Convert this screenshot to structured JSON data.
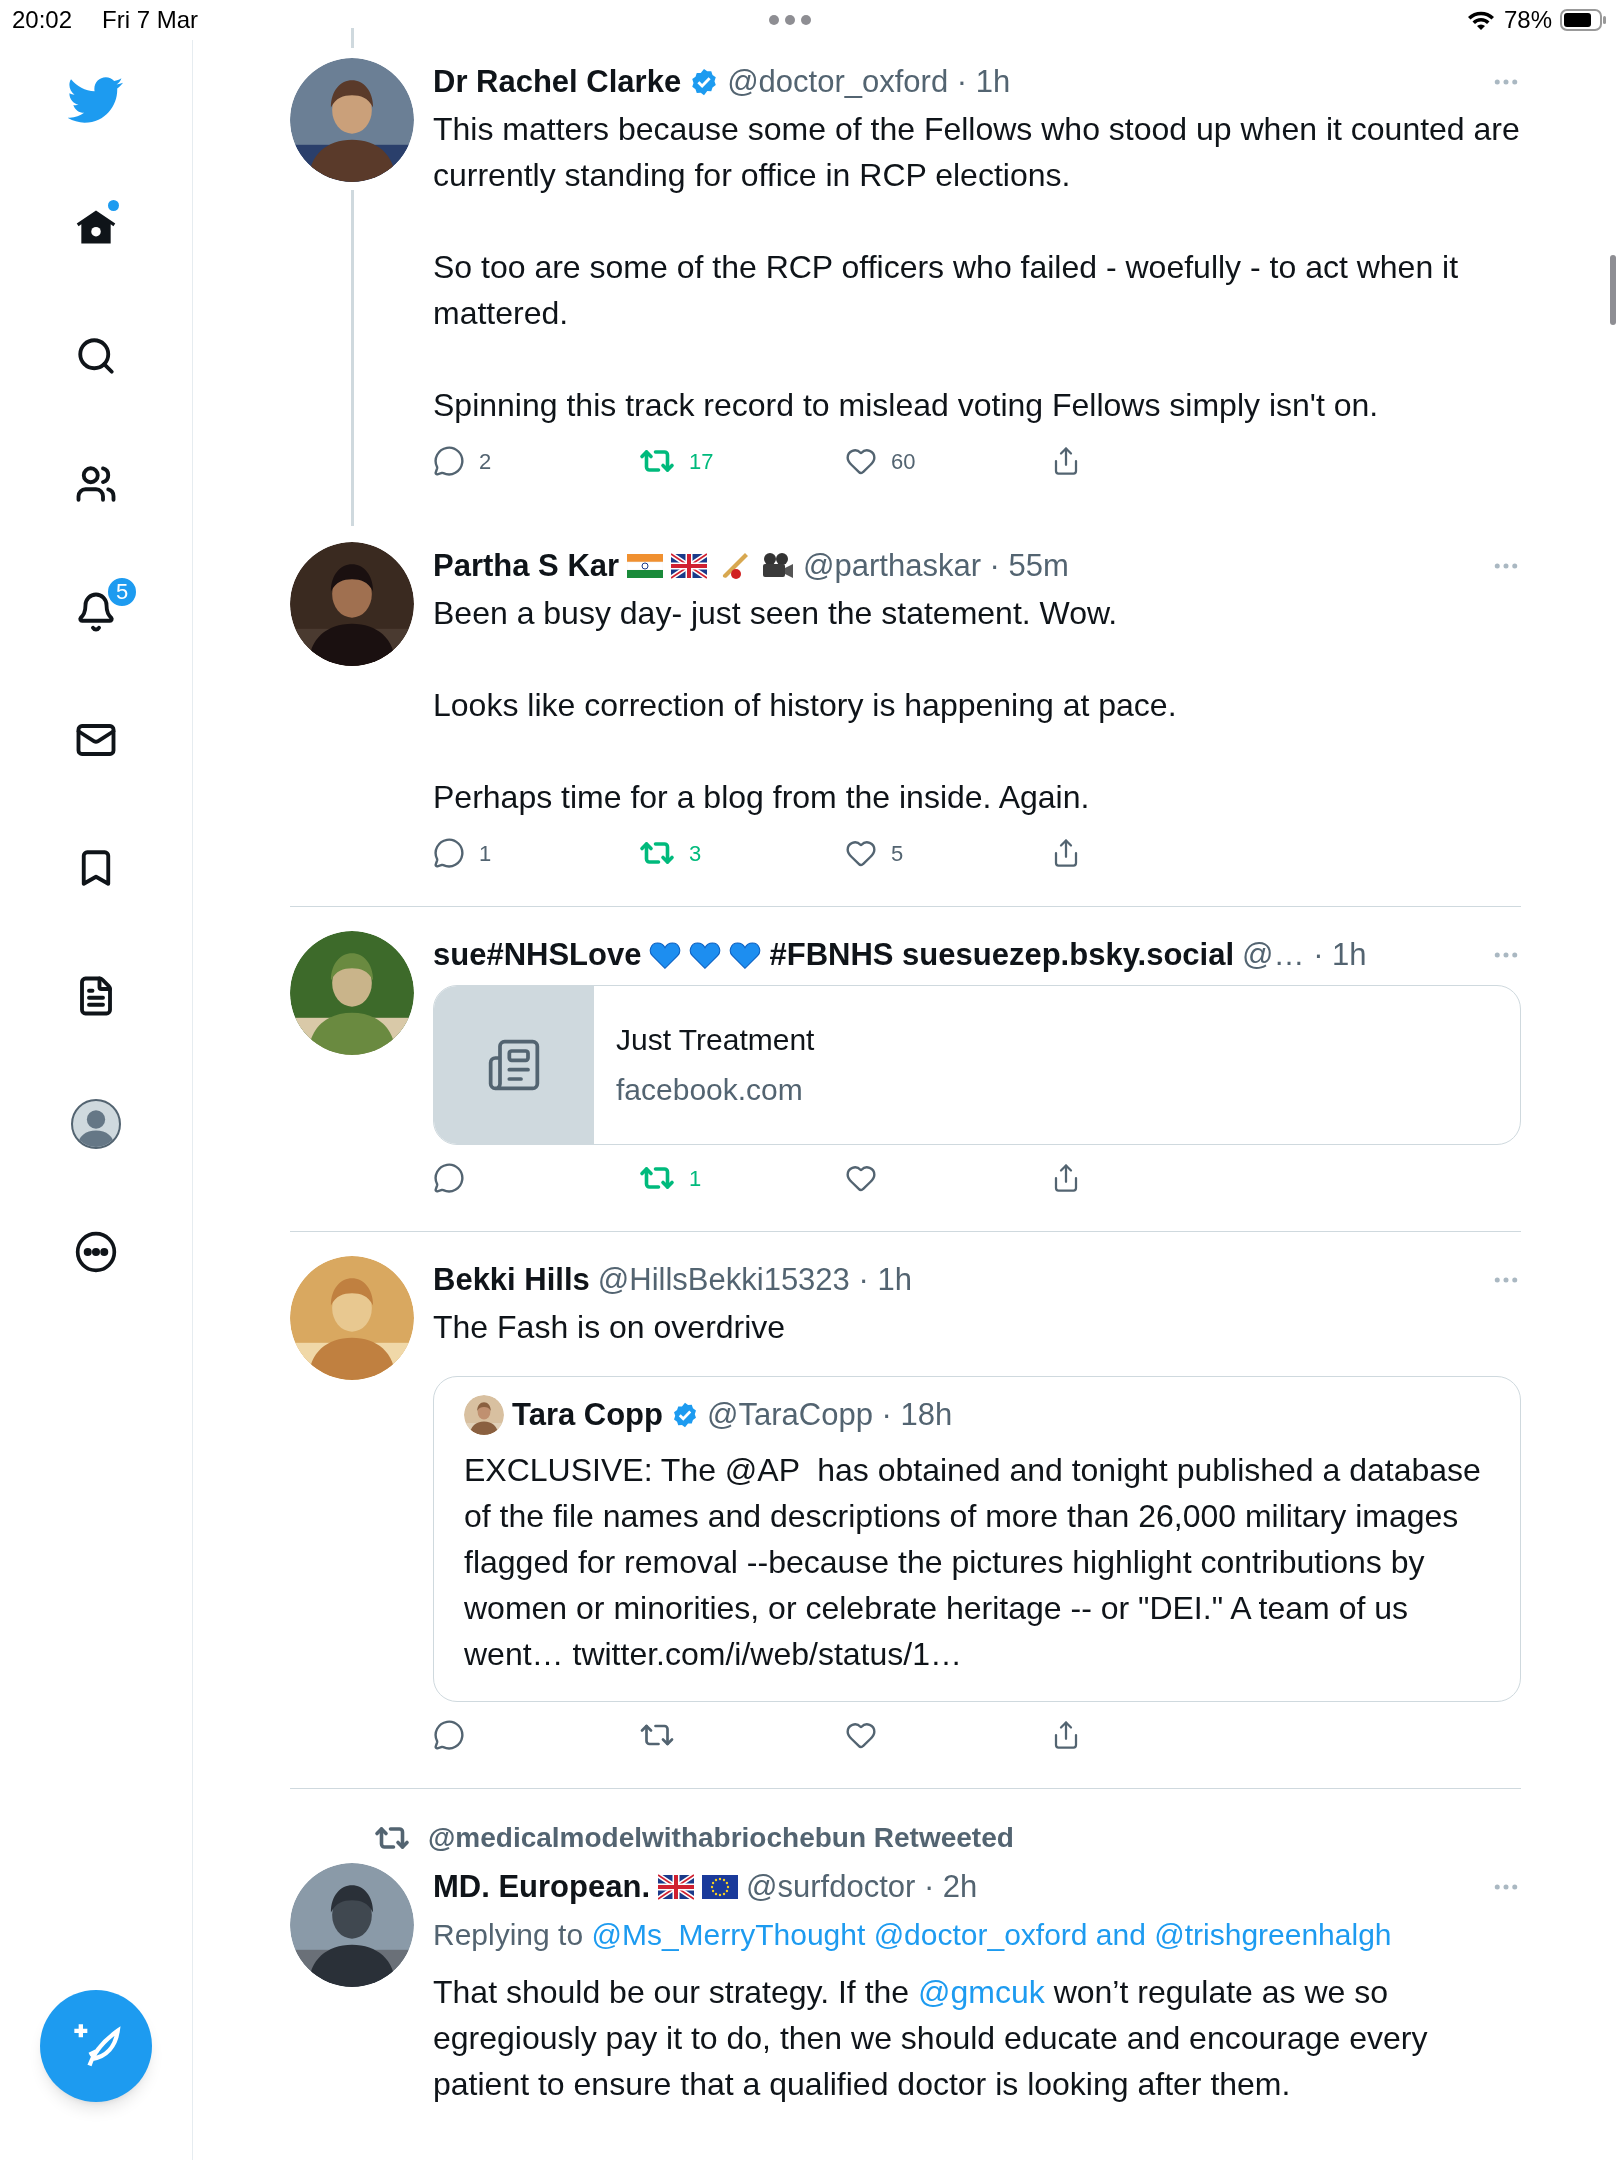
{
  "status_bar": {
    "time": "20:02",
    "date": "Fri 7 Mar",
    "battery": "78%"
  },
  "sidebar": {
    "items": [
      {
        "kind": "logo",
        "unread": false
      },
      {
        "kind": "home",
        "unread": true
      },
      {
        "kind": "search",
        "unread": false
      },
      {
        "kind": "communities",
        "unread": false
      },
      {
        "kind": "notifications",
        "unread": false,
        "badge": "5"
      },
      {
        "kind": "messages",
        "unread": false
      },
      {
        "kind": "bookmarks",
        "unread": false
      },
      {
        "kind": "lists",
        "unread": false
      },
      {
        "kind": "profile",
        "unread": false
      },
      {
        "kind": "more",
        "unread": false
      }
    ]
  },
  "tweets": [
    {
      "name": [
        {
          "kind": "text",
          "text": "Dr Rachel Clarke"
        }
      ],
      "verified": true,
      "meta": "@doctor_oxford · 1h",
      "thread_above": true,
      "thread_below": true,
      "body": [
        [
          {
            "kind": "text",
            "text": "This matters because some of the Fellows who stood up when it counted are currently standing for office in RCP elections."
          }
        ],
        [
          {
            "kind": "text",
            "text": "So too are some of the RCP officers who failed - woefully - to act when it mattered."
          }
        ],
        [
          {
            "kind": "text",
            "text": "Spinning this track record to mislead voting Fellows simply isn't on."
          }
        ]
      ],
      "actions": {
        "replies": "2",
        "retweets": "17",
        "likes": "60",
        "retweeted": true
      }
    },
    {
      "name": [
        {
          "kind": "text",
          "text": "Partha S Kar"
        },
        {
          "kind": "flag-india"
        },
        {
          "kind": "flag-uk"
        },
        {
          "kind": "cricket"
        },
        {
          "kind": "camera"
        }
      ],
      "verified": false,
      "meta": "@parthaskar · 55m",
      "thread_above": false,
      "thread_below": false,
      "body": [
        [
          {
            "kind": "text",
            "text": "Been a busy day- just seen the statement. Wow."
          }
        ],
        [
          {
            "kind": "text",
            "text": "Looks like correction of history is happening at pace."
          }
        ],
        [
          {
            "kind": "text",
            "text": "Perhaps time for a blog from the inside. Again."
          }
        ]
      ],
      "actions": {
        "replies": "1",
        "retweets": "3",
        "likes": "5",
        "retweeted": true
      }
    },
    {
      "name": [
        {
          "kind": "text",
          "text": "sue#NHSLove"
        },
        {
          "kind": "heart"
        },
        {
          "kind": "heart"
        },
        {
          "kind": "heart"
        },
        {
          "kind": "text",
          "text": "#FBNHS suesuezep.bsky.social"
        }
      ],
      "verified": false,
      "meta": "@… · 1h",
      "thread_above": false,
      "thread_below": false,
      "card": {
        "title": "Just Treatment",
        "domain": "facebook.com"
      },
      "actions": {
        "retweets": "1",
        "retweeted": true
      }
    },
    {
      "name": [
        {
          "kind": "text",
          "text": "Bekki Hills"
        }
      ],
      "verified": false,
      "meta": "@HillsBekki15323 · 1h",
      "thread_above": false,
      "thread_below": false,
      "body": [
        [
          {
            "kind": "text",
            "text": "The Fash is on overdrive"
          }
        ]
      ],
      "quote": {
        "name": "Tara Copp",
        "verified": true,
        "meta": "@TaraCopp · 18h",
        "text": "EXCLUSIVE: The @AP  has obtained and tonight published a database of the file names and descriptions of more than 26,000 military images flagged for removal --because the pictures highlight contributions by women or minorities, or celebrate heritage -- or \"DEI.\" A team of us went… twitter.com/i/web/status/1…"
      },
      "actions": {
        "retweeted": false
      }
    },
    {
      "retweeted_by": "@medicalmodelwithabriochebun Retweeted",
      "name": [
        {
          "kind": "text",
          "text": "MD. European."
        },
        {
          "kind": "flag-uk"
        },
        {
          "kind": "flag-eu"
        }
      ],
      "verified": false,
      "meta": "@surfdoctor · 2h",
      "thread_above": false,
      "thread_below": false,
      "replying_label": "Replying to",
      "replying_to": "@Ms_MerryThought @doctor_oxford and @trishgreenhalgh",
      "body": [
        [
          {
            "kind": "text",
            "text": "That should be our strategy. If the "
          },
          {
            "kind": "mention",
            "text": "@gmcuk"
          },
          {
            "kind": "text",
            "text": " won’t regulate as we so egregiously pay it to do, then we should educate and encourage every patient to ensure that a qualified doctor is looking after them."
          }
        ]
      ]
    }
  ]
}
